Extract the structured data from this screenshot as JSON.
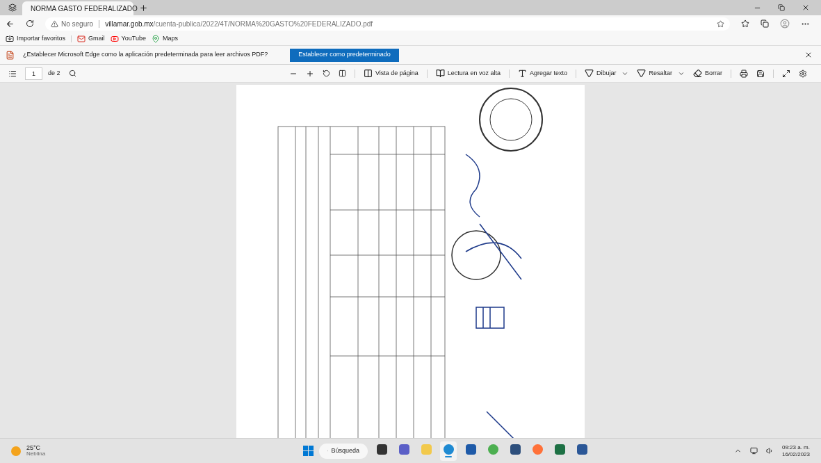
{
  "tabs": [
    {
      "title": "NORMA GASTO FEDERALIZADO",
      "selected": true
    }
  ],
  "address": {
    "security": "No seguro",
    "host": "villamar.gob.mx",
    "path": "/cuenta-publica/2022/4T/NORMA%20GASTO%20FEDERALIZADO.pdf"
  },
  "bookmarks": [
    {
      "label": "Importar favoritos",
      "kind": "import"
    },
    {
      "label": "Gmail",
      "kind": "gmail"
    },
    {
      "label": "YouTube",
      "kind": "youtube"
    },
    {
      "label": "Maps",
      "kind": "maps"
    }
  ],
  "infobar": {
    "message": "¿Establecer Microsoft Edge como la aplicación predeterminada para leer archivos PDF?",
    "button": "Establecer como predeterminado"
  },
  "pdf_toolbar": {
    "page": "1",
    "page_count": "de 2",
    "tools": [
      {
        "label": "Vista de página",
        "kind": "view",
        "dropdown": false
      },
      {
        "label": "Lectura en voz alta",
        "kind": "read",
        "dropdown": false
      },
      {
        "label": "Agregar texto",
        "kind": "text",
        "dropdown": false
      },
      {
        "label": "Dibujar",
        "kind": "draw",
        "dropdown": true
      },
      {
        "label": "Resaltar",
        "kind": "highlight",
        "dropdown": true
      },
      {
        "label": "Borrar",
        "kind": "erase",
        "dropdown": false
      }
    ]
  },
  "taskbar": {
    "weather": {
      "temperature": "25°C",
      "condition": "Neblina"
    },
    "search": "Búsqueda",
    "apps": [
      {
        "kind": "taskview",
        "selected": false
      },
      {
        "kind": "chat",
        "selected": false
      },
      {
        "kind": "files",
        "selected": false
      },
      {
        "kind": "edge",
        "selected": true
      },
      {
        "kind": "store",
        "selected": false
      },
      {
        "kind": "chrome",
        "selected": false
      },
      {
        "kind": "app",
        "selected": false
      },
      {
        "kind": "firefox",
        "selected": false
      },
      {
        "kind": "excel",
        "selected": false
      },
      {
        "kind": "word",
        "selected": false
      }
    ],
    "time": "09:23 a. m.",
    "date": "16/02/2023"
  }
}
